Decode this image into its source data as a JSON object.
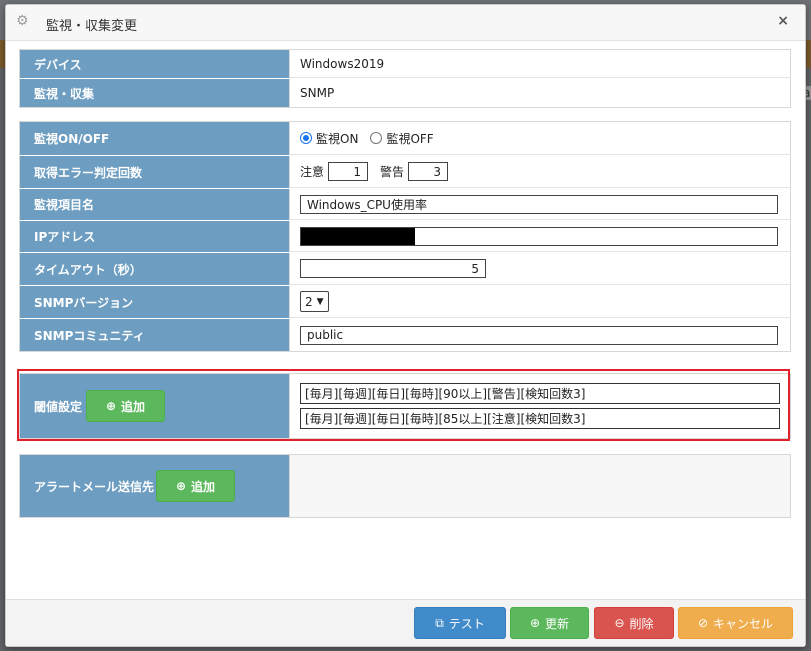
{
  "window": {
    "title": "監視・収集変更",
    "close_label": "×"
  },
  "info": {
    "rows": [
      {
        "label": "デバイス",
        "value": "Windows2019"
      },
      {
        "label": "監視・収集",
        "value": "SNMP"
      }
    ]
  },
  "form": {
    "monitor_label": "監視ON/OFF",
    "monitor_on": "監視ON",
    "monitor_off": "監視OFF",
    "error_label": "取得エラー判定回数",
    "caution_label": "注意",
    "caution_value": "1",
    "warning_label": "警告",
    "warning_value": "3",
    "item_name_label": "監視項目名",
    "item_name_value": "Windows_CPU使用率",
    "ip_label": "IPアドレス",
    "timeout_label": "タイムアウト（秒）",
    "timeout_value": "5",
    "snmp_version_label": "SNMPバージョン",
    "snmp_version_value": "2",
    "snmp_community_label": "SNMPコミュニティ",
    "snmp_community_value": "public"
  },
  "threshold": {
    "label": "閾値設定",
    "add_label": "追加",
    "items": [
      "[毎月][毎週][毎日][毎時][90以上][警告][検知回数3]",
      "[毎月][毎週][毎日][毎時][85以上][注意][検知回数3]"
    ]
  },
  "alert_mail": {
    "label": "アラートメール送信先",
    "add_label": "追加"
  },
  "footer": {
    "test_label": "テスト",
    "update_label": "更新",
    "delete_label": "削除",
    "cancel_label": "キャンセル"
  },
  "background": {
    "edge_letter": "a"
  },
  "colors": {
    "label_bg": "#6d9dc0",
    "highlight": "#e0202b",
    "green": "#5cb85c",
    "blue": "#428bca",
    "red": "#d9534f",
    "orange": "#f0ad4e"
  }
}
